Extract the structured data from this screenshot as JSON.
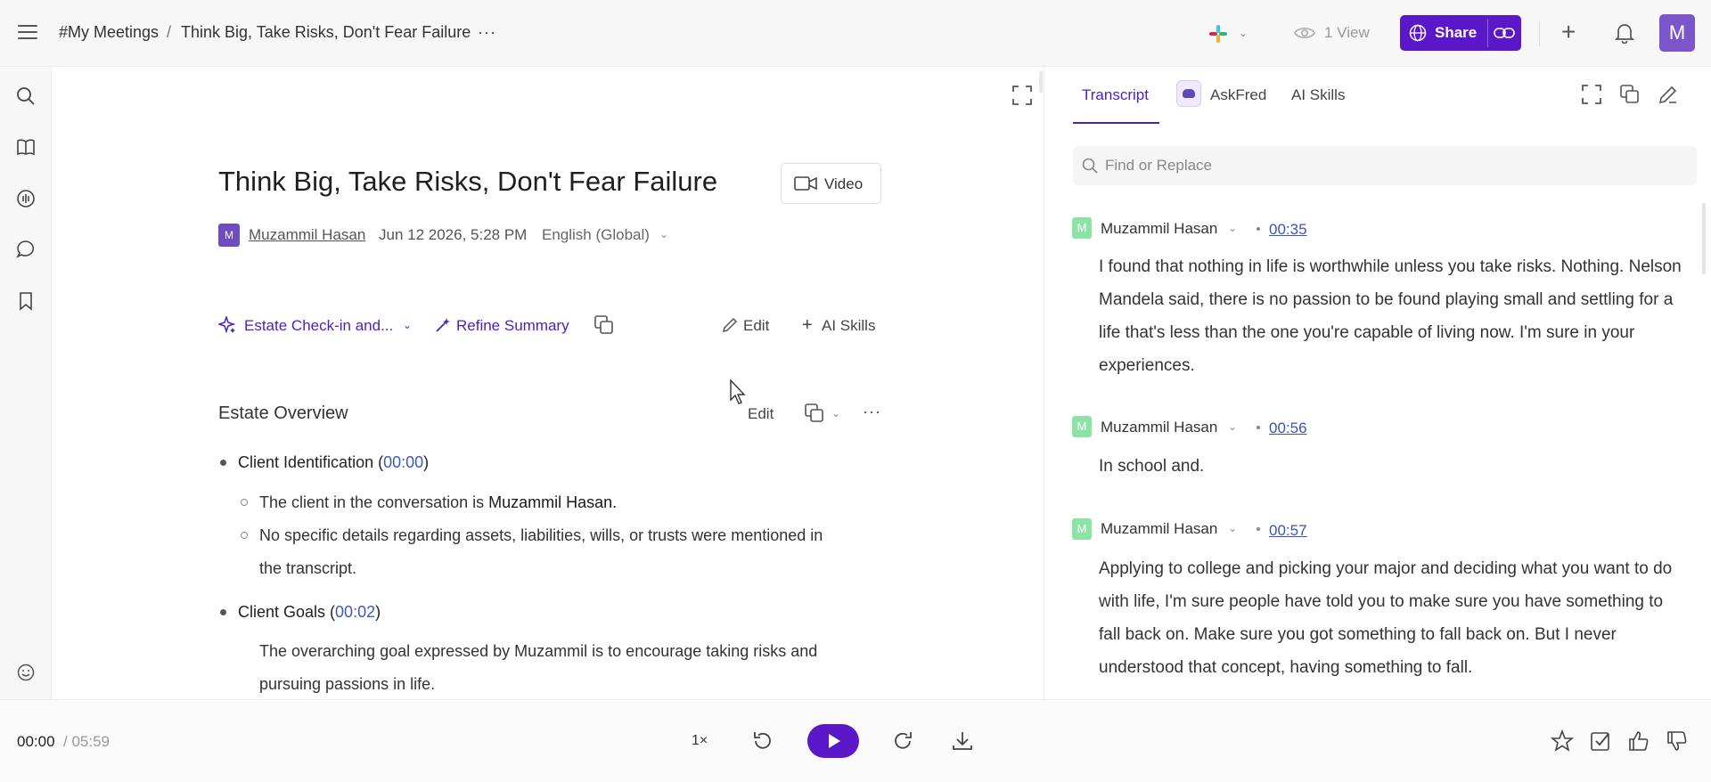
{
  "topbar": {
    "breadcrumb_root": "#My Meetings",
    "breadcrumb_sep": "/",
    "breadcrumb_current": "Think Big, Take Risks, Don't Fear Failure",
    "more": "···",
    "views": "1 View",
    "share_label": "Share",
    "user_initial": "M"
  },
  "doc": {
    "title": "Think Big, Take Risks, Don't Fear Failure",
    "video_label": "Video",
    "author_initial": "M",
    "author": "Muzammil Hasan",
    "date": "Jun 12 2026, 5:28 PM",
    "language": "English (Global)",
    "template_label": "Estate Check-in and...",
    "refine_label": "Refine Summary",
    "edit_label": "Edit",
    "ai_skills_label": "AI Skills",
    "section_title": "Estate Overview",
    "section_edit_label": "Edit",
    "bullets": [
      {
        "label": "Client Identification",
        "timestamp": "00:00",
        "subs": [
          {
            "text": "The client in the conversation is ",
            "bold": "Muzammil Hasan."
          },
          {
            "text": "No specific details regarding assets, liabilities, wills, or trusts were mentioned in",
            "text2": "the transcript."
          }
        ]
      },
      {
        "label": "Client Goals",
        "timestamp": "00:02",
        "subs": [
          {
            "text": "The overarching goal expressed by Muzammil is to encourage taking risks and",
            "text2": "pursuing passions in life."
          }
        ]
      }
    ]
  },
  "right_panel": {
    "tabs": [
      "Transcript",
      "AskFred",
      "AI Skills"
    ],
    "active_tab": "Transcript",
    "find_placeholder": "Find or Replace",
    "entries": [
      {
        "initial": "M",
        "speaker": "Muzammil Hasan",
        "timestamp": "00:35",
        "text": "I found that nothing in life is worthwhile unless you take risks. Nothing. Nelson Mandela said, there is no passion to be found playing small and settling for a life that's less than the one you're capable of living now. I'm sure in your experiences."
      },
      {
        "initial": "M",
        "speaker": "Muzammil Hasan",
        "timestamp": "00:56",
        "text": "In school and."
      },
      {
        "initial": "M",
        "speaker": "Muzammil Hasan",
        "timestamp": "00:57",
        "text": "Applying to college and picking your major and deciding what you want to do with life, I'm sure people have told you to make sure you have something to fall back on. Make sure you got something to fall back on. But I never understood that concept, having something to fall."
      }
    ]
  },
  "player": {
    "current_time": "00:00",
    "separator": "/",
    "duration": "05:59",
    "speed": "1×"
  },
  "colors": {
    "accent": "#5a18c8",
    "link": "#3b5bb5",
    "speaker_avatar": "#8be3a6",
    "user_avatar": "#7b55c9"
  }
}
